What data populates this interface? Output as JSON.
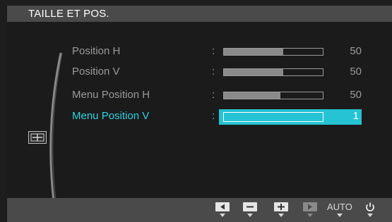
{
  "osd": {
    "title": "TAILLE ET POS.",
    "items": [
      {
        "label": "Position H",
        "value": "50",
        "level": 0.6
      },
      {
        "label": "Position V",
        "value": "50",
        "level": 0.6
      },
      {
        "label": "Menu Position H",
        "value": "50",
        "level": 0.57
      },
      {
        "label": "Menu Position V",
        "value": "1",
        "level": 0.0
      }
    ],
    "separator": ":",
    "buttons": {
      "auto_label": "AUTO"
    },
    "colors": {
      "highlight": "#25c3d3",
      "accent_text": "#2fd3e0",
      "background": "#1d1d1d",
      "bar_gray": "#4a4a4a"
    },
    "icons": [
      "left-arrow-icon",
      "minus-icon",
      "plus-icon",
      "enter-icon",
      "power-icon",
      "size-position-icon"
    ]
  }
}
